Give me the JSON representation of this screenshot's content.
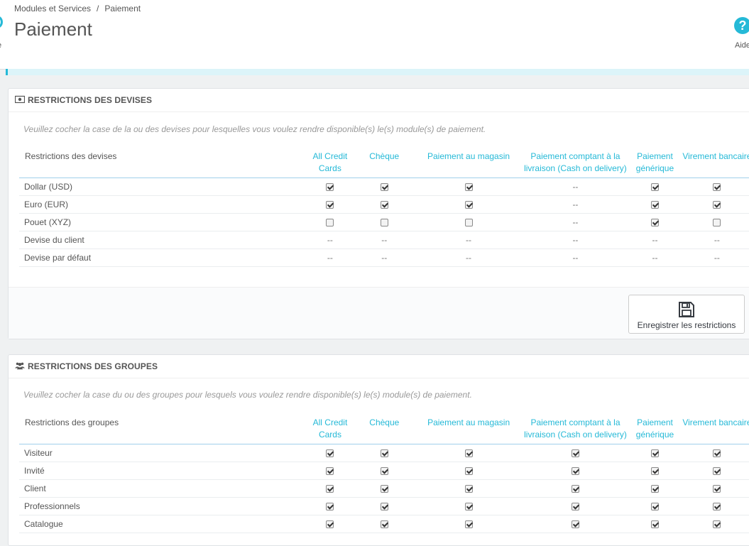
{
  "header": {
    "breadcrumb": [
      "Modules et Services",
      "Paiement"
    ],
    "breadcrumb_sep": "/",
    "title": "Paiement",
    "help_label": "Aide",
    "left_stub_label": "e"
  },
  "accent_color": "#25b9d7",
  "columns": [
    "All Credit Cards",
    "Chèque",
    "Paiement au magasin",
    "Paiement comptant à la livraison (Cash on delivery)",
    "Paiement générique",
    "Virement bancaire"
  ],
  "currency_panel": {
    "title": "RESTRICTIONS DES DEVISES",
    "description": "Veuillez cocher la case de la ou des devises pour lesquelles vous voulez rendre disponible(s) le(s) module(s) de paiement.",
    "first_header": "Restrictions des devises",
    "rows": [
      {
        "label": "Dollar (USD)",
        "cells": [
          true,
          true,
          true,
          "--",
          true,
          true
        ]
      },
      {
        "label": "Euro (EUR)",
        "cells": [
          true,
          true,
          true,
          "--",
          true,
          true
        ]
      },
      {
        "label": "Pouet (XYZ)",
        "cells": [
          false,
          false,
          false,
          "--",
          true,
          false
        ]
      },
      {
        "label": "Devise du client",
        "cells": [
          "--",
          "--",
          "--",
          "--",
          "--",
          "--"
        ]
      },
      {
        "label": "Devise par défaut",
        "cells": [
          "--",
          "--",
          "--",
          "--",
          "--",
          "--"
        ]
      }
    ],
    "save_label": "Enregistrer les restrictions"
  },
  "group_panel": {
    "title": "RESTRICTIONS DES GROUPES",
    "description": "Veuillez cocher la case du ou des groupes pour lesquels vous voulez rendre disponible(s) le(s) module(s) de paiement.",
    "first_header": "Restrictions des groupes",
    "rows": [
      {
        "label": "Visiteur",
        "cells": [
          true,
          true,
          true,
          true,
          true,
          true
        ]
      },
      {
        "label": "Invité",
        "cells": [
          true,
          true,
          true,
          true,
          true,
          true
        ]
      },
      {
        "label": "Client",
        "cells": [
          true,
          true,
          true,
          true,
          true,
          true
        ]
      },
      {
        "label": "Professionnels",
        "cells": [
          true,
          true,
          true,
          true,
          true,
          true
        ]
      },
      {
        "label": "Catalogue",
        "cells": [
          true,
          true,
          true,
          true,
          true,
          true
        ]
      }
    ]
  }
}
